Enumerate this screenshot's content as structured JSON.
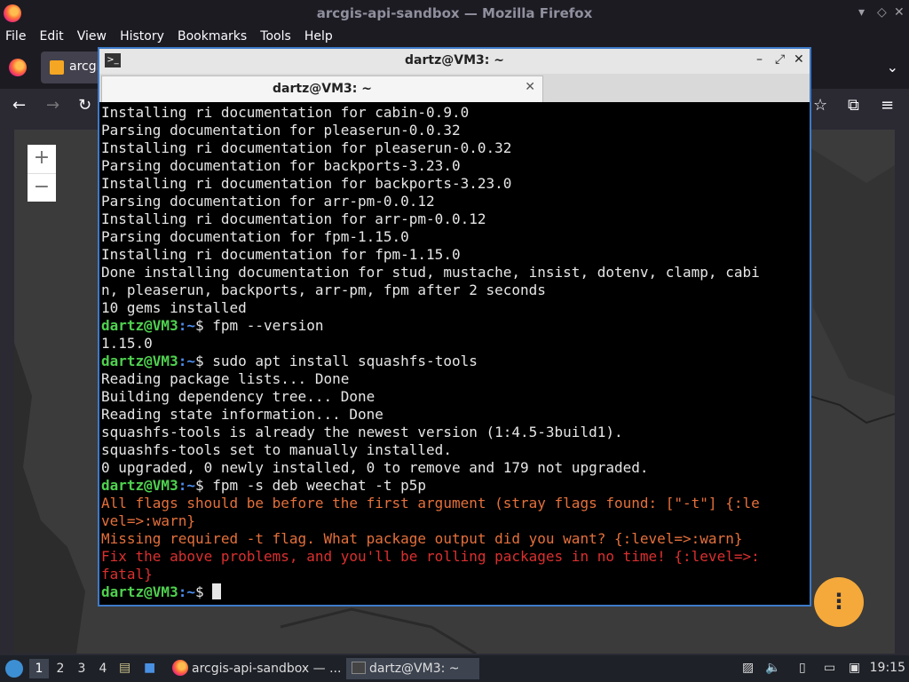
{
  "firefox": {
    "window_title": "arcgis-api-sandbox — Mozilla Firefox",
    "menu": [
      "File",
      "Edit",
      "View",
      "History",
      "Bookmarks",
      "Tools",
      "Help"
    ],
    "tab_label": "arcgi"
  },
  "map": {
    "zoom_in": "+",
    "zoom_out": "−",
    "fab": "⋮"
  },
  "terminal": {
    "window_title": "dartz@VM3: ~",
    "tab_label": "dartz@VM3: ~",
    "lines": [
      {
        "kind": "out",
        "text": "Installing ri documentation for cabin-0.9.0"
      },
      {
        "kind": "out",
        "text": "Parsing documentation for pleaserun-0.0.32"
      },
      {
        "kind": "out",
        "text": "Installing ri documentation for pleaserun-0.0.32"
      },
      {
        "kind": "out",
        "text": "Parsing documentation for backports-3.23.0"
      },
      {
        "kind": "out",
        "text": "Installing ri documentation for backports-3.23.0"
      },
      {
        "kind": "out",
        "text": "Parsing documentation for arr-pm-0.0.12"
      },
      {
        "kind": "out",
        "text": "Installing ri documentation for arr-pm-0.0.12"
      },
      {
        "kind": "out",
        "text": "Parsing documentation for fpm-1.15.0"
      },
      {
        "kind": "out",
        "text": "Installing ri documentation for fpm-1.15.0"
      },
      {
        "kind": "out",
        "text": "Done installing documentation for stud, mustache, insist, dotenv, clamp, cabi"
      },
      {
        "kind": "out",
        "text": "n, pleaserun, backports, arr-pm, fpm after 2 seconds"
      },
      {
        "kind": "out",
        "text": "10 gems installed"
      },
      {
        "kind": "prompt",
        "user": "dartz@VM3",
        "path": ":~",
        "cmd": "$ fpm --version"
      },
      {
        "kind": "out",
        "text": "1.15.0"
      },
      {
        "kind": "prompt",
        "user": "dartz@VM3",
        "path": ":~",
        "cmd": "$ sudo apt install squashfs-tools"
      },
      {
        "kind": "out",
        "text": "Reading package lists... Done"
      },
      {
        "kind": "out",
        "text": "Building dependency tree... Done"
      },
      {
        "kind": "out",
        "text": "Reading state information... Done"
      },
      {
        "kind": "out",
        "text": "squashfs-tools is already the newest version (1:4.5-3build1)."
      },
      {
        "kind": "out",
        "text": "squashfs-tools set to manually installed."
      },
      {
        "kind": "out",
        "text": "0 upgraded, 0 newly installed, 0 to remove and 179 not upgraded."
      },
      {
        "kind": "prompt",
        "user": "dartz@VM3",
        "path": ":~",
        "cmd": "$ fpm -s deb weechat -t p5p"
      },
      {
        "kind": "warn",
        "text": "All flags should be before the first argument (stray flags found: [\"-t\"] {:le"
      },
      {
        "kind": "warn",
        "text": "vel=>:warn}"
      },
      {
        "kind": "warn",
        "text": "Missing required -t flag. What package output did you want? {:level=>:warn}"
      },
      {
        "kind": "fatal",
        "text": "Fix the above problems, and you'll be rolling packages in no time! {:level=>:"
      },
      {
        "kind": "fatal",
        "text": "fatal}"
      },
      {
        "kind": "prompt",
        "user": "dartz@VM3",
        "path": ":~",
        "cmd": "$ ",
        "cursor": true
      }
    ]
  },
  "taskbar": {
    "workspaces": [
      "1",
      "2",
      "3",
      "4"
    ],
    "tasks": [
      {
        "label": "arcgis-api-sandbox — ..."
      },
      {
        "label": "dartz@VM3: ~"
      }
    ],
    "clock": "19:15"
  }
}
